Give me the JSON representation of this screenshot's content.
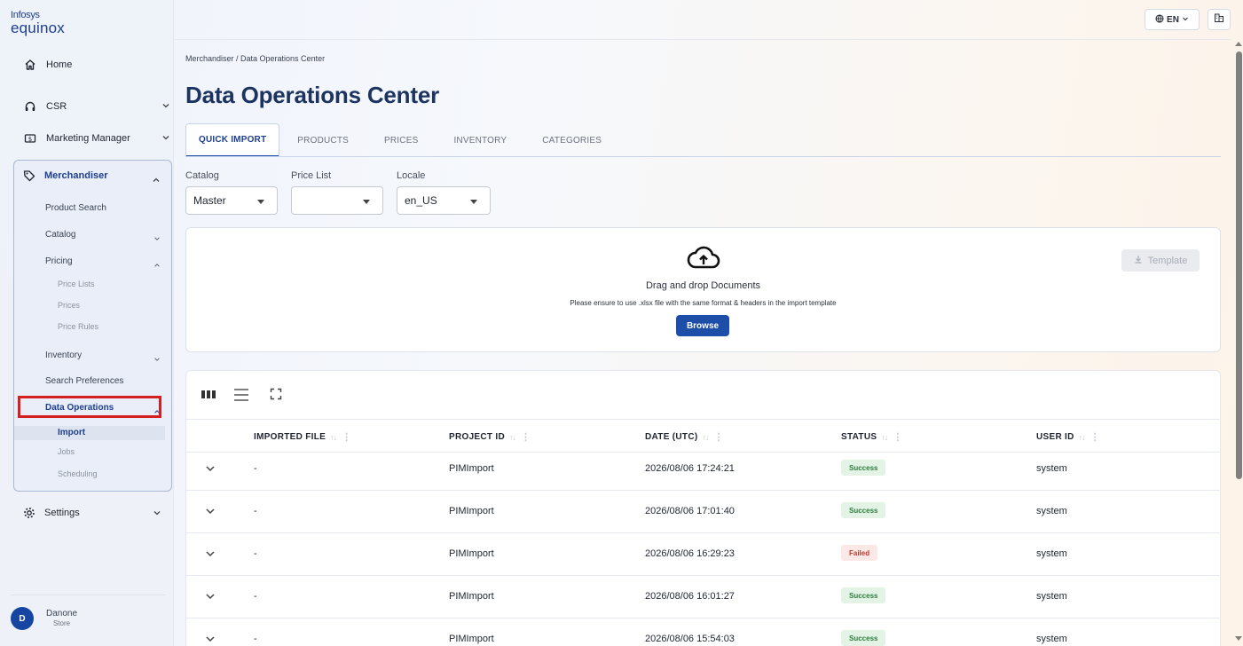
{
  "brand": {
    "line1": "Infosys",
    "line2": "equinox"
  },
  "sidebar": {
    "home": "Home",
    "csr": "CSR",
    "marketing": "Marketing Manager",
    "merchandiser": {
      "label": "Merchandiser",
      "product_search": "Product Search",
      "catalog": "Catalog",
      "pricing": "Pricing",
      "price_lists": "Price Lists",
      "prices": "Prices",
      "price_rules": "Price Rules",
      "inventory": "Inventory",
      "search_preferences": "Search Preferences",
      "data_operations": "Data Operations",
      "import": "Import",
      "jobs": "Jobs",
      "scheduling": "Scheduling"
    },
    "settings": "Settings",
    "user": {
      "initial": "D",
      "name": "Danone",
      "store": "Store"
    }
  },
  "topbar": {
    "language": "EN"
  },
  "breadcrumb": "Merchandiser / Data Operations Center",
  "page_title": "Data Operations Center",
  "tabs": [
    {
      "label": "QUICK IMPORT",
      "active": true
    },
    {
      "label": "PRODUCTS"
    },
    {
      "label": "PRICES"
    },
    {
      "label": "INVENTORY"
    },
    {
      "label": "CATEGORIES"
    }
  ],
  "filters": {
    "catalog": {
      "label": "Catalog",
      "value": "Master"
    },
    "price_list": {
      "label": "Price List",
      "value": ""
    },
    "locale": {
      "label": "Locale",
      "value": "en_US"
    }
  },
  "upload": {
    "title": "Drag and drop Documents",
    "hint": "Please ensure to use .xlsx file with the same format & headers in the import template",
    "browse": "Browse",
    "template": "Template"
  },
  "table": {
    "columns": [
      "IMPORTED FILE",
      "PROJECT ID",
      "DATE (UTC)",
      "STATUS",
      "USER ID"
    ],
    "rows": [
      {
        "file": "-",
        "project": "PIMImport",
        "date": "2026/08/06 17:24:21",
        "status": "Success",
        "user": "system"
      },
      {
        "file": "-",
        "project": "PIMImport",
        "date": "2026/08/06 17:01:40",
        "status": "Success",
        "user": "system"
      },
      {
        "file": "-",
        "project": "PIMImport",
        "date": "2026/08/06 16:29:23",
        "status": "Failed",
        "user": "system"
      },
      {
        "file": "-",
        "project": "PIMImport",
        "date": "2026/08/06 16:01:27",
        "status": "Success",
        "user": "system"
      },
      {
        "file": "-",
        "project": "PIMImport",
        "date": "2026/08/06 15:54:03",
        "status": "Success",
        "user": "system"
      }
    ]
  },
  "colors": {
    "primary": "#1d4ea8",
    "title": "#1d3461",
    "success_bg": "#e3f3e6",
    "success_fg": "#2e7d3a",
    "failed_bg": "#fde8e8",
    "failed_fg": "#c0392b",
    "highlight": "#d42020"
  }
}
